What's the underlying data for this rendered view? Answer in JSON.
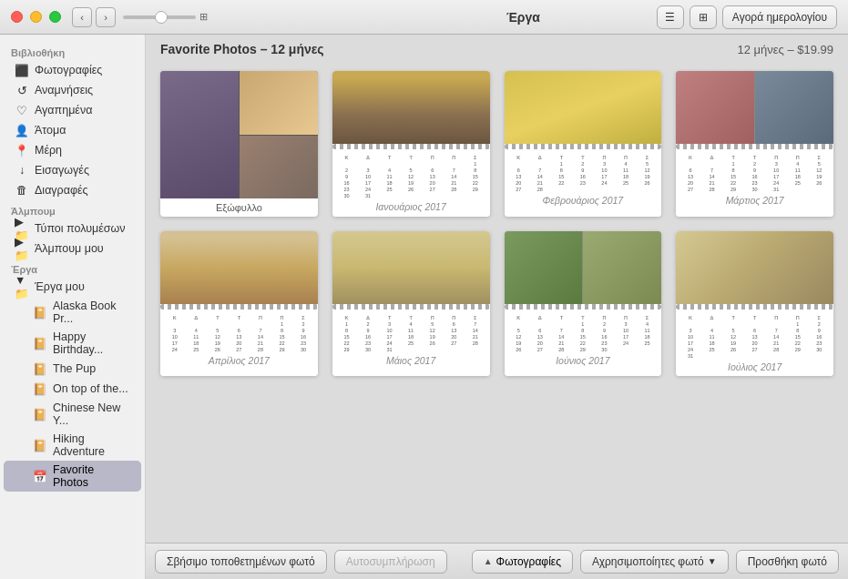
{
  "window": {
    "title": "Έργα"
  },
  "titlebar": {
    "back_label": "‹",
    "forward_label": "›",
    "title": "Έργα",
    "view_btn1": "☰",
    "view_btn2": "⊞",
    "buy_btn": "Αγορά ημερολογίου"
  },
  "sidebar": {
    "library_header": "Βιβλιοθήκη",
    "library_items": [
      {
        "id": "photos",
        "label": "Φωτογραφίες",
        "icon": "photo"
      },
      {
        "id": "memories",
        "label": "Αναμνήσεις",
        "icon": "memory"
      },
      {
        "id": "favorites",
        "label": "Αγαπημένα",
        "icon": "heart"
      },
      {
        "id": "people",
        "label": "Άτομα",
        "icon": "person"
      },
      {
        "id": "places",
        "label": "Μέρη",
        "icon": "pin"
      },
      {
        "id": "imports",
        "label": "Εισαγωγές",
        "icon": "import"
      },
      {
        "id": "deleted",
        "label": "Διαγραφές",
        "icon": "trash"
      }
    ],
    "album_header": "Άλμπουμ",
    "album_items": [
      {
        "id": "album-types",
        "label": "Τύποι πολυμέσων",
        "icon": "folder"
      },
      {
        "id": "my-albums",
        "label": "Άλμπουμ μου",
        "icon": "folder"
      }
    ],
    "projects_header": "Έργα",
    "project_items": [
      {
        "id": "my-projects",
        "label": "Έργα μου",
        "icon": "folder"
      },
      {
        "id": "alaska",
        "label": "Alaska Book Pr...",
        "icon": "book"
      },
      {
        "id": "birthday",
        "label": "Happy Birthday...",
        "icon": "book"
      },
      {
        "id": "pup",
        "label": "The Pup",
        "icon": "book"
      },
      {
        "id": "ontop",
        "label": "On top of the...",
        "icon": "book"
      },
      {
        "id": "chinese",
        "label": "Chinese New Y...",
        "icon": "book"
      },
      {
        "id": "hiking",
        "label": "Hiking Adventure",
        "icon": "book"
      },
      {
        "id": "favorite-photos",
        "label": "Favorite Photos",
        "icon": "calendar",
        "active": true
      }
    ]
  },
  "content": {
    "title": "Favorite Photos – 12 μήνες",
    "price": "12 μήνες – $19.99",
    "cover_label": "Εξώφυλλο",
    "months": [
      {
        "id": "jan",
        "label": "Ιανουάριος 2017"
      },
      {
        "id": "feb",
        "label": "Φεβρουάριος 2017"
      },
      {
        "id": "mar",
        "label": "Μάρτιος 2017"
      },
      {
        "id": "apr",
        "label": "Απρίλιος 2017"
      },
      {
        "id": "may",
        "label": "Μάιος 2017"
      },
      {
        "id": "jun",
        "label": "Ιούνιος 2017"
      },
      {
        "id": "jul",
        "label": "Ιούλιος 2017"
      }
    ]
  },
  "calendar": {
    "days_header": [
      "Κ",
      "Δ",
      "Τ",
      "Τ",
      "Π",
      "Π",
      "Σ"
    ],
    "jan_days": [
      "1",
      "2",
      "3",
      "4",
      "5",
      "6",
      "7",
      "8",
      "9",
      "10",
      "11",
      "12",
      "13",
      "14",
      "15",
      "16",
      "17",
      "18",
      "19",
      "20",
      "21",
      "22",
      "23",
      "24",
      "25",
      "26",
      "27",
      "28",
      "29",
      "30",
      "31"
    ],
    "month_label_jan": "Ιανουάριος 2017",
    "month_label_feb": "Φεβρουάριος 2017",
    "month_label_mar": "Μάρτιος 2017",
    "month_label_apr": "Απρίλιος 2017",
    "month_label_may": "Μάιος 2017",
    "month_label_jun": "Ιούνιος 2017",
    "month_label_jul": "Ιούλιος 2017"
  },
  "bottom_toolbar": {
    "delete_photos": "Σβήσιμο τοποθετημένων φωτό",
    "autocomplete": "Αυτοσυμπλήρωση",
    "photos_label": "Φωτογραφίες",
    "unused_label": "Αχρησιμοποίητες φωτό",
    "add_photo": "Προσθήκη φωτό"
  }
}
